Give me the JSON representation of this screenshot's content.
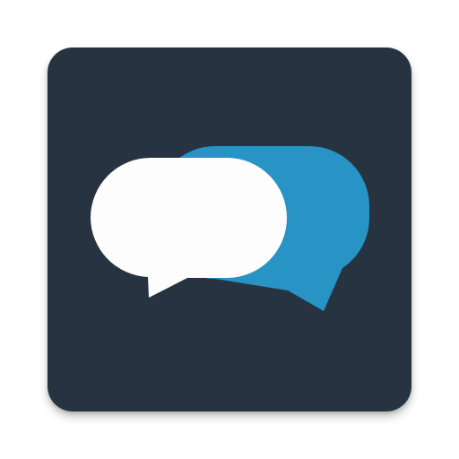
{
  "app_icon": {
    "icon_name": "chat-bubbles-icon",
    "colors": {
      "background": "#273340",
      "front_bubble": "#FDFDFD",
      "back_bubble": "#2893C5"
    }
  }
}
